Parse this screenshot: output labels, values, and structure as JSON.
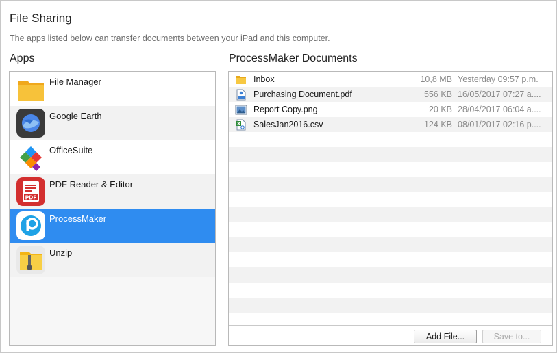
{
  "header": {
    "title": "File Sharing",
    "description": "The apps listed below can transfer documents between your iPad and this computer."
  },
  "apps": {
    "title": "Apps",
    "items": [
      {
        "label": "File Manager",
        "icon": "folder-icon"
      },
      {
        "label": "Google Earth",
        "icon": "google-earth-icon"
      },
      {
        "label": "OfficeSuite",
        "icon": "officesuite-icon"
      },
      {
        "label": "PDF Reader & Editor",
        "icon": "pdf-icon"
      },
      {
        "label": "ProcessMaker",
        "icon": "processmaker-icon",
        "selected": true
      },
      {
        "label": "Unzip",
        "icon": "zip-folder-icon"
      }
    ]
  },
  "documents": {
    "title": "ProcessMaker Documents",
    "files": [
      {
        "name": "Inbox",
        "size": "10,8 MB",
        "date": "Yesterday 09:57 p.m.",
        "icon": "folder-icon"
      },
      {
        "name": "Purchasing Document.pdf",
        "size": "556 KB",
        "date": "16/05/2017  07:27  a....",
        "icon": "pdf-file-icon"
      },
      {
        "name": "Report Copy.png",
        "size": "20 KB",
        "date": "28/04/2017  06:04  a....",
        "icon": "image-file-icon"
      },
      {
        "name": "SalesJan2016.csv",
        "size": "124 KB",
        "date": "08/01/2017  02:16  p....",
        "icon": "csv-file-icon"
      }
    ],
    "add_button": "Add File...",
    "save_button": "Save to..."
  },
  "colors": {
    "selection": "#2f8cf0",
    "row_alt": "#f2f2f2"
  }
}
